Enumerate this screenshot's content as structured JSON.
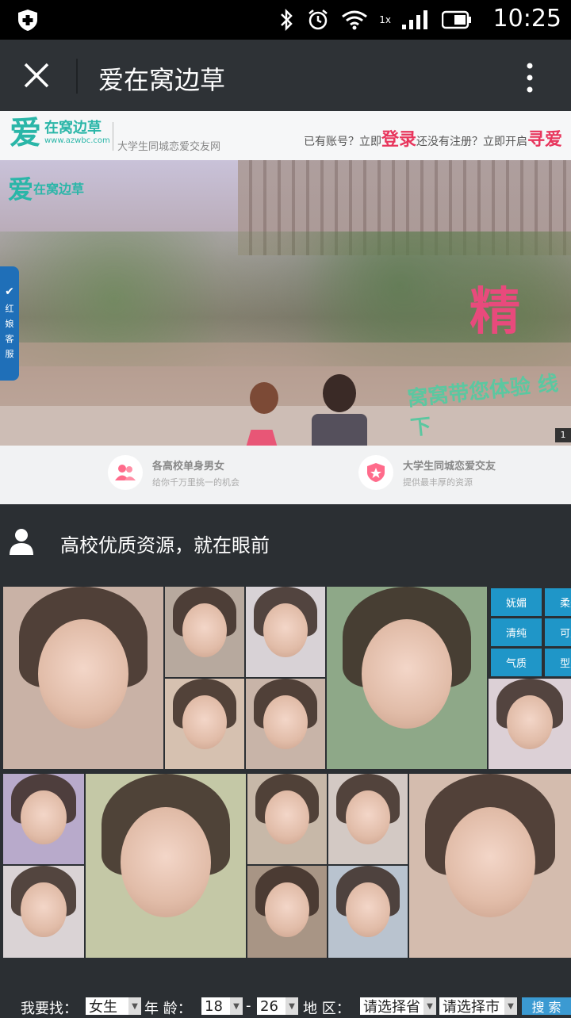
{
  "status": {
    "time": "10:25",
    "signal_label": "1x"
  },
  "toolbar": {
    "title": "爱在窝边草"
  },
  "site": {
    "logo_char": "爱",
    "logo_name": "在窝边草",
    "logo_url": "www.azwbc.com",
    "slogan": "大学生同城恋爱交友网",
    "account_prefix": "已有账号？立即",
    "login": "登录",
    "account_middle": "还没有注册？立即开启",
    "register": "寻爱"
  },
  "banner": {
    "big_text": "精",
    "green_text": "窝窝带您体验 线下",
    "pager": "1",
    "watermark_char": "爱",
    "watermark_name": "在窝边草"
  },
  "side_tab": {
    "text": "红娘客服"
  },
  "features": [
    {
      "title": "各高校单身男女",
      "sub": "给你千万里挑一的机会"
    },
    {
      "title": "大学生同城恋爱交友",
      "sub": "提供最丰厚的资源"
    }
  ],
  "section": {
    "title": "高校优质资源，就在眼前"
  },
  "tags": [
    "妩媚",
    "柔美",
    "清纯",
    "可爱",
    "气质",
    "型男"
  ],
  "search": {
    "find_label": "我要找：",
    "gender": "女生",
    "age_label": "年  龄：",
    "age_from": "18",
    "dash": "-",
    "age_to": "26",
    "region_label": "地  区：",
    "region1": "请选择省",
    "region2": "请选择市",
    "button": "搜 索"
  },
  "colors": {
    "accent": "#2ab6a8",
    "brand_red": "#e8365d",
    "tag_blue": "#1f96c8",
    "dark_bg": "#2b2f33"
  }
}
